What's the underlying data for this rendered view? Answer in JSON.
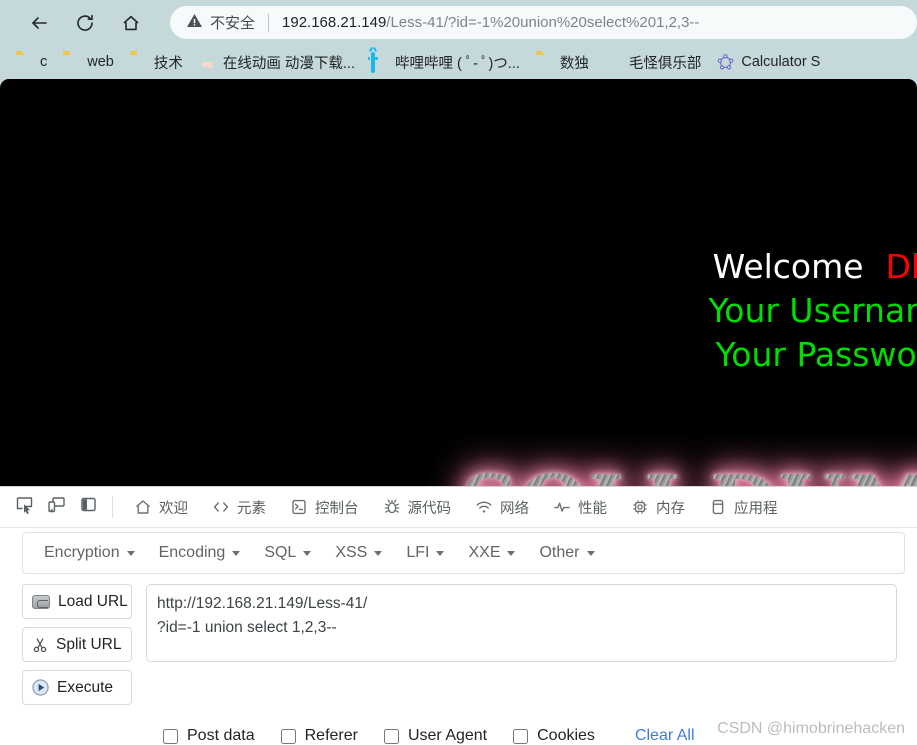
{
  "browser": {
    "nav": {
      "back_title": "Back",
      "reload_title": "Reload",
      "home_title": "Home"
    },
    "omnibox": {
      "security_label": "不安全",
      "url_host": "192.168.21.149",
      "url_path": "/Less-41/?id=-1%20union%20select%201,2,3--",
      "full_url": "192.168.21.149/Less-41/?id=-1%20union%20select%201,2,3--"
    },
    "bookmarks": [
      {
        "label": "c",
        "icon": "folder-icon"
      },
      {
        "label": "web",
        "icon": "folder-icon"
      },
      {
        "label": "技术",
        "icon": "folder-icon"
      },
      {
        "label": "在线动画 动漫下载...",
        "icon": "anime-favicon"
      },
      {
        "label": "哔哩哔哩 ( ﾟ- ﾟ)つ...",
        "icon": "bilibili-favicon"
      },
      {
        "label": "数独",
        "icon": "folder-icon"
      },
      {
        "label": "毛怪俱乐部",
        "icon": "photo-favicon"
      },
      {
        "label": "Calculator S",
        "icon": "geogebra-favicon"
      }
    ]
  },
  "page": {
    "welcome_label": "Welcome",
    "user_name": "Dhakk",
    "username_line": "Your Username is",
    "password_line": "Your Password is",
    "logo_text": "SOLI DUMB S",
    "colors": {
      "welcome": "#ffffff",
      "name": "#ff0000",
      "credentials": "#00dd00",
      "background": "#000000",
      "logo_glow": "#ff7aa6"
    }
  },
  "devtools": {
    "left_icons": [
      {
        "name": "inspect-element-icon"
      },
      {
        "name": "device-toolbar-icon"
      },
      {
        "name": "dock-side-icon"
      }
    ],
    "tabs": [
      {
        "label": "欢迎",
        "icon": "home-icon"
      },
      {
        "label": "元素",
        "icon": "code-brackets-icon"
      },
      {
        "label": "控制台",
        "icon": "console-icon"
      },
      {
        "label": "源代码",
        "icon": "bug-icon"
      },
      {
        "label": "网络",
        "icon": "wifi-icon"
      },
      {
        "label": "性能",
        "icon": "performance-icon"
      },
      {
        "label": "内存",
        "icon": "memory-chip-icon"
      },
      {
        "label": "应用程",
        "icon": "application-icon"
      }
    ]
  },
  "hackbar": {
    "menus": [
      {
        "label": "Encryption"
      },
      {
        "label": "Encoding"
      },
      {
        "label": "SQL"
      },
      {
        "label": "XSS"
      },
      {
        "label": "LFI"
      },
      {
        "label": "XXE"
      },
      {
        "label": "Other"
      }
    ],
    "buttons": [
      {
        "label": "Load URL",
        "icon": "load-url-icon"
      },
      {
        "label": "Split URL",
        "icon": "scissors-icon"
      },
      {
        "label": "Execute",
        "icon": "play-icon"
      }
    ],
    "request_value": "http://192.168.21.149/Less-41/\n?id=-1 union select 1,2,3--",
    "request_placeholder": "",
    "options": [
      {
        "label": "Post data",
        "checked": false
      },
      {
        "label": "Referer",
        "checked": false
      },
      {
        "label": "User Agent",
        "checked": false
      },
      {
        "label": "Cookies",
        "checked": false
      }
    ],
    "clear_all_label": "Clear All",
    "clear_all_color": "#3b7dd8"
  },
  "watermark": {
    "text": "CSDN @himobrinehacken"
  }
}
